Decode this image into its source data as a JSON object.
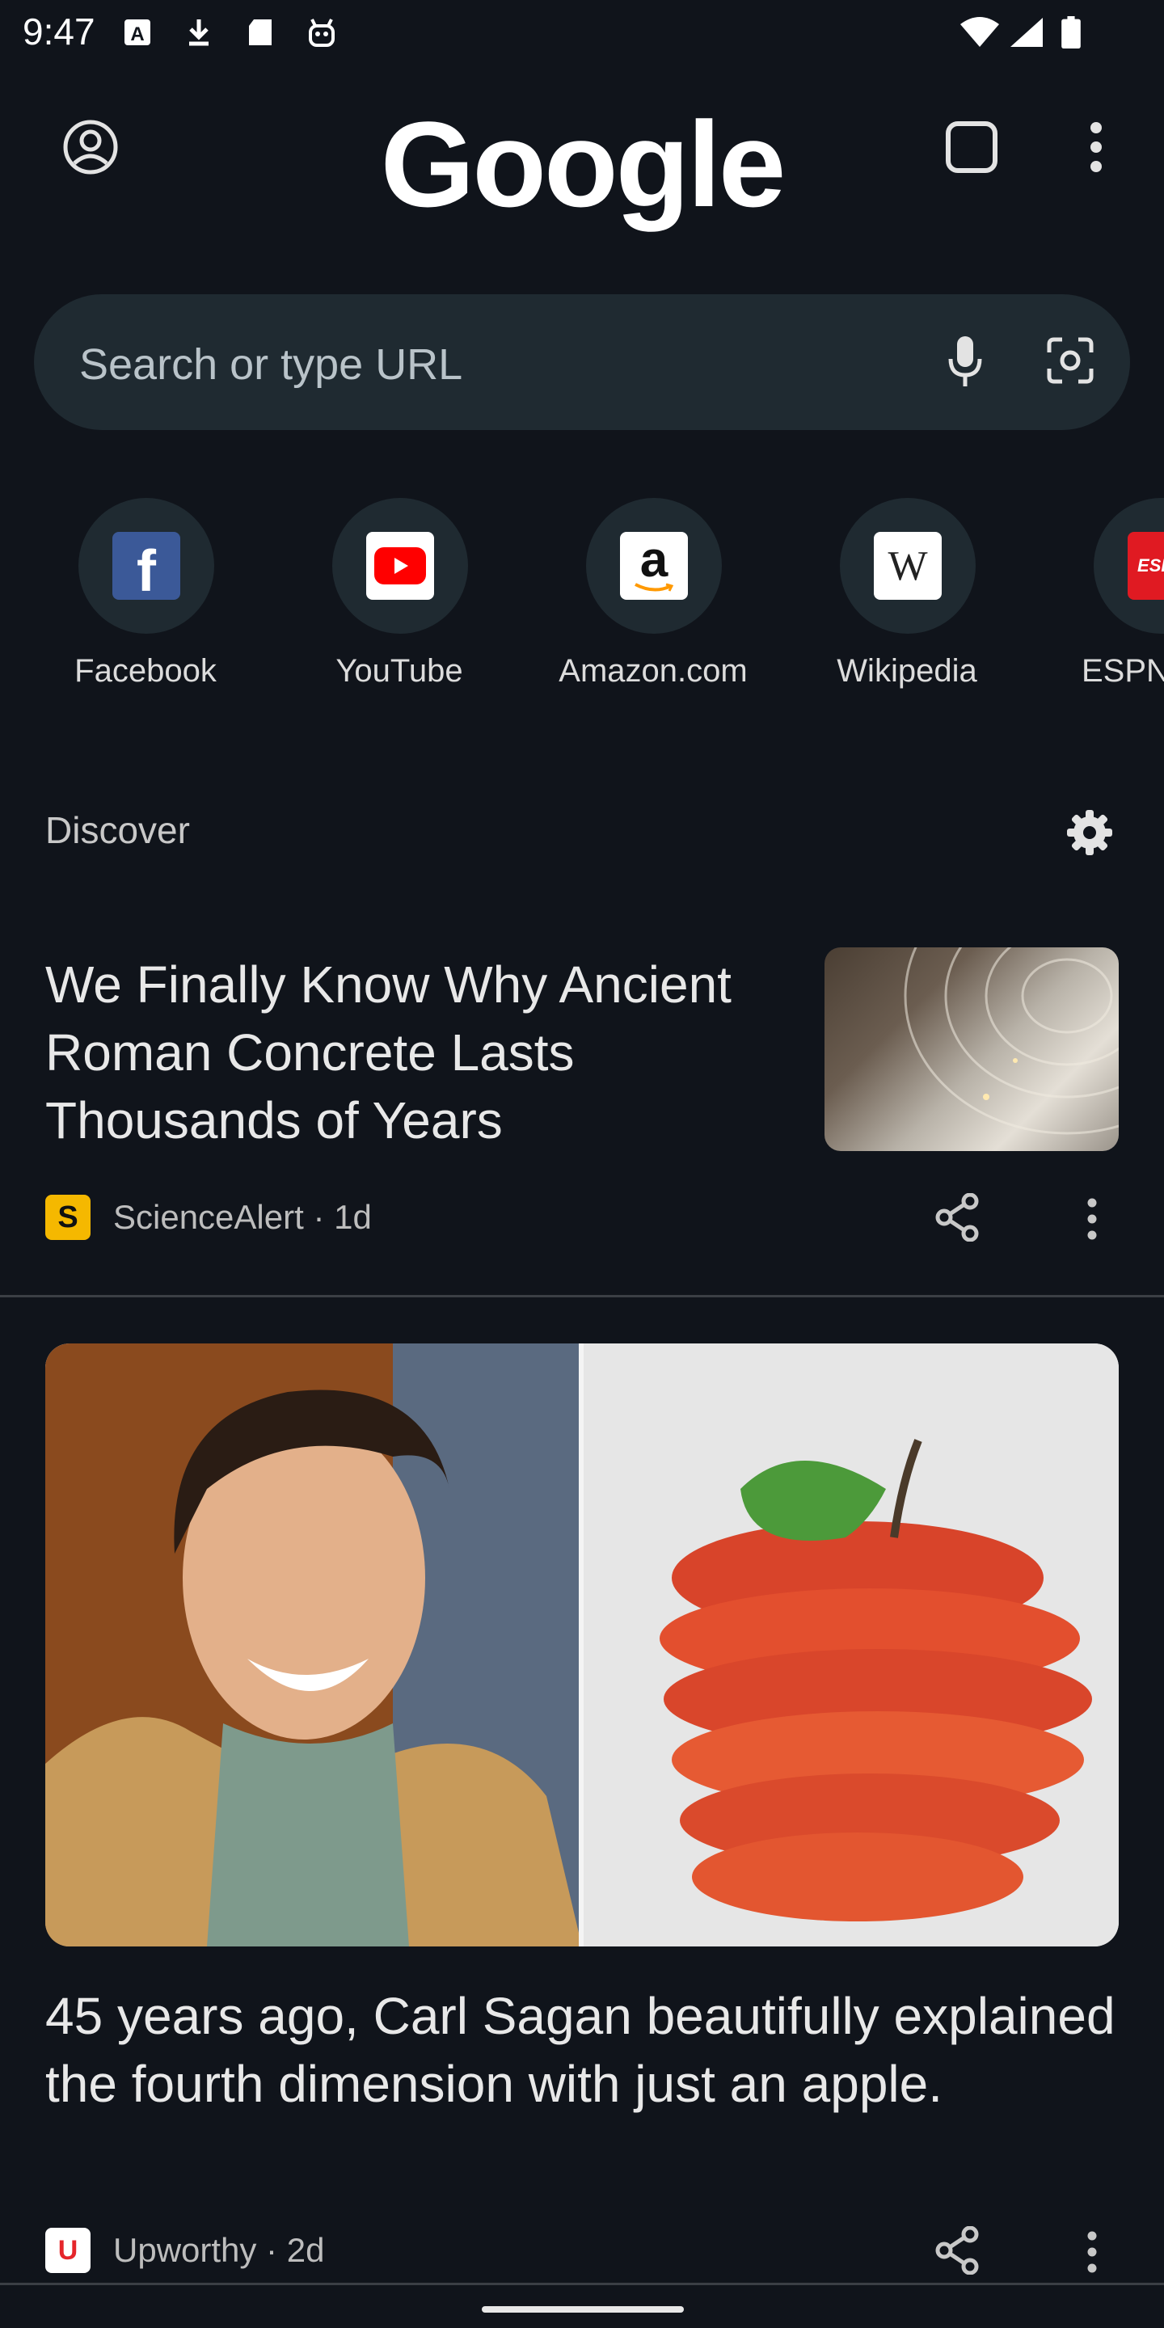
{
  "status_bar": {
    "time": "9:47",
    "left_icons": [
      "a-notification-icon",
      "download-icon",
      "sd-card-icon",
      "android-icon"
    ],
    "right_icons": [
      "wifi-icon",
      "signal-icon",
      "battery-icon"
    ]
  },
  "header": {
    "logo_text": "Google",
    "account_icon": "account-circle-icon",
    "tabs_icon": "tab-switcher-icon",
    "menu_icon": "more-vert-icon"
  },
  "search": {
    "placeholder": "Search or type URL",
    "mic_icon": "mic-icon",
    "lens_icon": "lens-icon"
  },
  "shortcuts": [
    {
      "label": "Facebook",
      "icon": "facebook-icon",
      "color": "#3b5998"
    },
    {
      "label": "YouTube",
      "icon": "youtube-icon",
      "color": "#ff0000"
    },
    {
      "label": "Amazon.com",
      "icon": "amazon-icon",
      "color": "#ffffff"
    },
    {
      "label": "Wikipedia",
      "icon": "wikipedia-icon",
      "color": "#ffffff"
    },
    {
      "label": "ESPN",
      "icon": "espn-icon",
      "color": "#e01a22"
    }
  ],
  "discover": {
    "label": "Discover",
    "settings_icon": "gear-icon"
  },
  "articles": [
    {
      "title": "We Finally Know Why Ancient Roman Concrete Lasts Thousands of Years",
      "source": "ScienceAlert · 1d",
      "source_logo": "S",
      "image": "pantheon-dome-photo"
    },
    {
      "title": "45 years ago, Carl Sagan beautifully explained the fourth dimension with just an apple.",
      "source": "Upworthy · 2d",
      "source_logo": "U",
      "image": "carl-sagan-and-sliced-apple-photo"
    }
  ],
  "colors": {
    "background": "#10141b",
    "surface": "#1f2a31",
    "text": "#e3e3e3",
    "science_alert": "#f5b800",
    "upworthy": "#e5262b"
  }
}
